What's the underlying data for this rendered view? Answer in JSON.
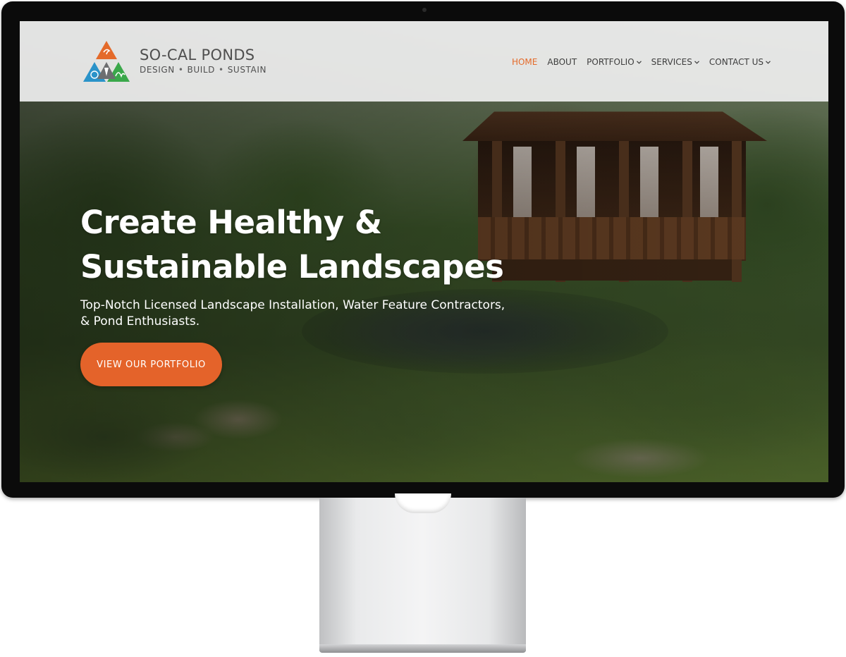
{
  "brand": {
    "name": "SO-CAL PONDS",
    "tagline": [
      "DESIGN",
      "BUILD",
      "SUSTAIN"
    ],
    "logo_colors": [
      "#e46a2a",
      "#2a93c9",
      "#3aa84a",
      "#6d6e70"
    ]
  },
  "nav": {
    "items": [
      {
        "label": "HOME",
        "active": true,
        "has_dropdown": false
      },
      {
        "label": "ABOUT",
        "active": false,
        "has_dropdown": false
      },
      {
        "label": "PORTFOLIO",
        "active": false,
        "has_dropdown": true
      },
      {
        "label": "SERVICES",
        "active": false,
        "has_dropdown": true
      },
      {
        "label": "CONTACT US",
        "active": false,
        "has_dropdown": true
      }
    ]
  },
  "hero": {
    "heading_line1": "Create Healthy &",
    "heading_line2": "Sustainable Landscapes",
    "subheading": "Top-Notch Licensed Landscape Installation, Water Feature Contractors, & Pond Enthusiasts.",
    "cta_label": "VIEW OUR PORTFOLIO"
  },
  "colors": {
    "accent": "#e4632a",
    "nav_text": "#3d3d3d",
    "header_bg": "#eeeeee"
  },
  "icons": {
    "dropdown": "chevron-down-icon"
  }
}
